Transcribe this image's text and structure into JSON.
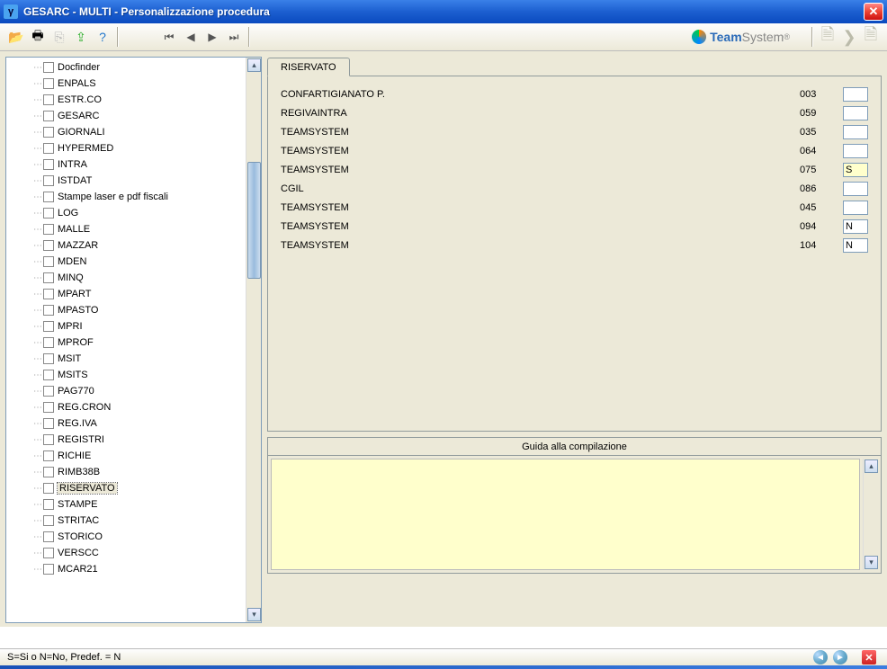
{
  "window": {
    "title": "GESARC  - MULTI -  Personalizzazione procedura",
    "app_icon_letter": "γ"
  },
  "brand": {
    "name1": "Team",
    "name2": "System",
    "reg": "®"
  },
  "tree": {
    "items": [
      {
        "label": "Docfinder"
      },
      {
        "label": "ENPALS"
      },
      {
        "label": "ESTR.CO"
      },
      {
        "label": "GESARC"
      },
      {
        "label": "GIORNALI"
      },
      {
        "label": "HYPERMED"
      },
      {
        "label": "INTRA"
      },
      {
        "label": "ISTDAT"
      },
      {
        "label": "Stampe laser e pdf fiscali"
      },
      {
        "label": "LOG"
      },
      {
        "label": "MALLE"
      },
      {
        "label": "MAZZAR"
      },
      {
        "label": "MDEN"
      },
      {
        "label": "MINQ"
      },
      {
        "label": "MPART"
      },
      {
        "label": "MPASTO"
      },
      {
        "label": "MPRI"
      },
      {
        "label": "MPROF"
      },
      {
        "label": "MSIT"
      },
      {
        "label": "MSITS"
      },
      {
        "label": "PAG770"
      },
      {
        "label": "REG.CRON"
      },
      {
        "label": "REG.IVA"
      },
      {
        "label": "REGISTRI"
      },
      {
        "label": "RICHIE"
      },
      {
        "label": "RIMB38B"
      },
      {
        "label": "RISERVATO"
      },
      {
        "label": "STAMPE"
      },
      {
        "label": "STRITAC"
      },
      {
        "label": "STORICO"
      },
      {
        "label": "VERSCC"
      },
      {
        "label": "MCAR21"
      }
    ],
    "selected_index": 26
  },
  "tab": {
    "label": "RISERVATO"
  },
  "rows": [
    {
      "label": "CONFARTIGIANATO P.",
      "code": "003",
      "value": ""
    },
    {
      "label": "REGIVAINTRA",
      "code": "059",
      "value": ""
    },
    {
      "label": "TEAMSYSTEM",
      "code": "035",
      "value": ""
    },
    {
      "label": "TEAMSYSTEM",
      "code": "064",
      "value": ""
    },
    {
      "label": "TEAMSYSTEM",
      "code": "075",
      "value": "S",
      "active": true
    },
    {
      "label": "CGIL",
      "code": "086",
      "value": ""
    },
    {
      "label": "TEAMSYSTEM",
      "code": "045",
      "value": ""
    },
    {
      "label": "TEAMSYSTEM",
      "code": "094",
      "value": "N"
    },
    {
      "label": "TEAMSYSTEM",
      "code": "104",
      "value": "N"
    }
  ],
  "guide": {
    "title": "Guida alla compilazione"
  },
  "status": {
    "hint": "S=Si o N=No, Predef. = N"
  }
}
